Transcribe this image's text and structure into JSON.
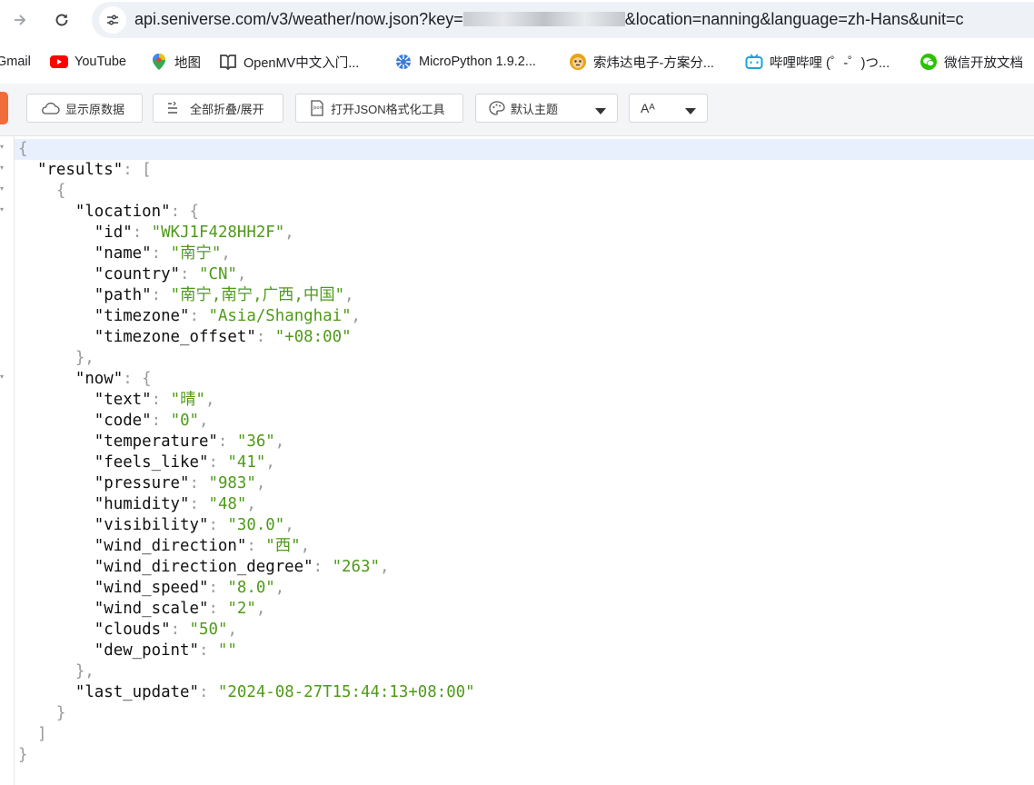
{
  "browser": {
    "url_host": "api.seniverse.com",
    "url_path": "/v3/weather/now.json?key=",
    "url_rest": "&location=nanning&language=zh-Hans&unit=c"
  },
  "bookmarks": [
    {
      "label": "Gmail",
      "icon": "gmail-icon"
    },
    {
      "label": "YouTube",
      "icon": "youtube-icon"
    },
    {
      "label": "地图",
      "icon": "maps-icon"
    },
    {
      "label": "OpenMV中文入门...",
      "icon": "book-icon"
    },
    {
      "label": "MicroPython 1.9.2...",
      "icon": "micropython-icon"
    },
    {
      "label": "索炜达电子-方案分...",
      "icon": "monkey-icon"
    },
    {
      "label": "哔哩哔哩 (゜-゜)つ...",
      "icon": "bilibili-icon"
    },
    {
      "label": "微信开放文档",
      "icon": "wechat-icon"
    }
  ],
  "toolbar": {
    "raw_label": "显示原数据",
    "fold_label": "全部折叠/展开",
    "formatter_label": "打开JSON格式化工具",
    "theme_label": "默认主题",
    "font_label": "Aᴬ"
  },
  "json": {
    "results_key": "results",
    "location_key": "location",
    "location": [
      {
        "key": "id",
        "value": "WKJ1F428HH2F"
      },
      {
        "key": "name",
        "value": "南宁"
      },
      {
        "key": "country",
        "value": "CN"
      },
      {
        "key": "path",
        "value": "南宁,南宁,广西,中国"
      },
      {
        "key": "timezone",
        "value": "Asia/Shanghai"
      },
      {
        "key": "timezone_offset",
        "value": "+08:00"
      }
    ],
    "now_key": "now",
    "now": [
      {
        "key": "text",
        "value": "晴"
      },
      {
        "key": "code",
        "value": "0"
      },
      {
        "key": "temperature",
        "value": "36"
      },
      {
        "key": "feels_like",
        "value": "41"
      },
      {
        "key": "pressure",
        "value": "983"
      },
      {
        "key": "humidity",
        "value": "48"
      },
      {
        "key": "visibility",
        "value": "30.0"
      },
      {
        "key": "wind_direction",
        "value": "西"
      },
      {
        "key": "wind_direction_degree",
        "value": "263"
      },
      {
        "key": "wind_speed",
        "value": "8.0"
      },
      {
        "key": "wind_scale",
        "value": "2"
      },
      {
        "key": "clouds",
        "value": "50"
      },
      {
        "key": "dew_point",
        "value": ""
      }
    ],
    "last_update_key": "last_update",
    "last_update_value": "2024-08-27T15:44:13+08:00"
  },
  "colors": {
    "string": "#4f9a19",
    "punct": "#999999",
    "accent": "#f26b3a"
  }
}
